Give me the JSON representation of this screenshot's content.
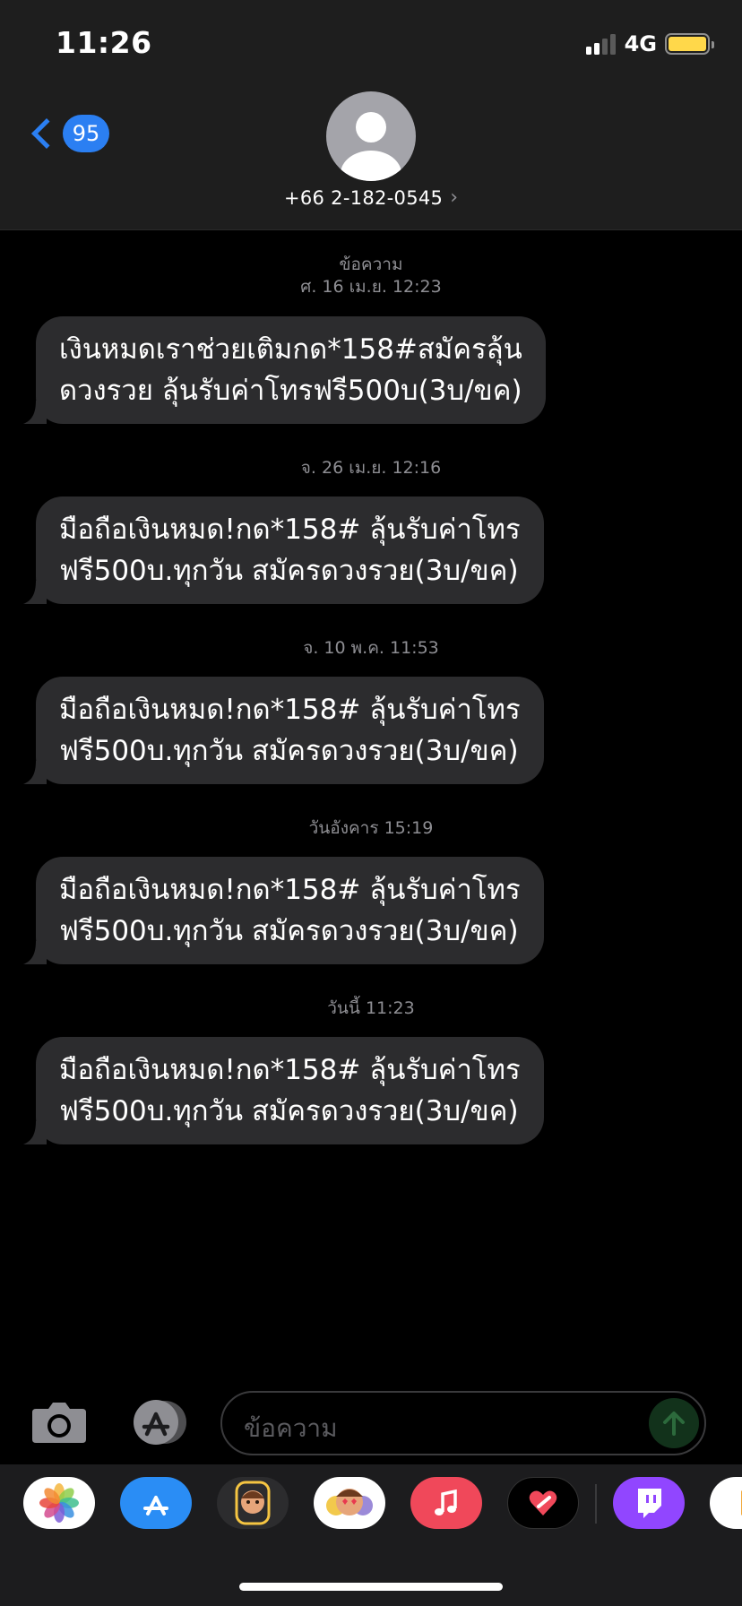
{
  "status_bar": {
    "time": "11:26",
    "network": "4G",
    "battery_color": "#ffd84a",
    "signal_bars_active": 2,
    "signal_bars_total": 4
  },
  "header": {
    "back_count": "95",
    "contact": "+66 2-182-0545",
    "contact_chevron": "›",
    "accent_color": "#2b7ff2"
  },
  "thread": {
    "messages": [
      {
        "timestamp": "ข้อความ",
        "timestamp2": "ศ. 16 เม.ย. 12:23",
        "lines": [
          "เงินหมดเราช่วยเติมกด*158#สมัครลุ้น",
          "ดวงรวย ลุ้นรับค่าโทรฟรี500บ(3บ/ขค)"
        ]
      },
      {
        "timestamp": "จ. 26 เม.ย. 12:16",
        "lines": [
          "มือถือเงินหมด!กด*158# ลุ้นรับค่าโทร",
          "ฟรี500บ.ทุกวัน สมัครดวงรวย(3บ/ขค)"
        ]
      },
      {
        "timestamp": "จ. 10 พ.ค. 11:53",
        "lines": [
          "มือถือเงินหมด!กด*158# ลุ้นรับค่าโทร",
          "ฟรี500บ.ทุกวัน สมัครดวงรวย(3บ/ขค)"
        ]
      },
      {
        "timestamp": "วันอังคาร 15:19",
        "lines": [
          "มือถือเงินหมด!กด*158# ลุ้นรับค่าโทร",
          "ฟรี500บ.ทุกวัน สมัครดวงรวย(3บ/ขค)"
        ]
      },
      {
        "timestamp": "วันนี้ 11:23",
        "lines": [
          "มือถือเงินหมด!กด*158# ลุ้นรับค่าโทร",
          "ฟรี500บ.ทุกวัน สมัครดวงรวย(3บ/ขค)"
        ]
      }
    ]
  },
  "compose": {
    "placeholder": "ข้อความ",
    "camera_icon": "camera-icon",
    "apps_icon": "app-store-icon",
    "send_icon": "send-arrow-icon"
  },
  "app_drawer": {
    "apps": [
      "photos",
      "app-store",
      "memoji",
      "animoji-stickers",
      "music",
      "digital-touch",
      "twitch",
      "partial-app"
    ]
  }
}
